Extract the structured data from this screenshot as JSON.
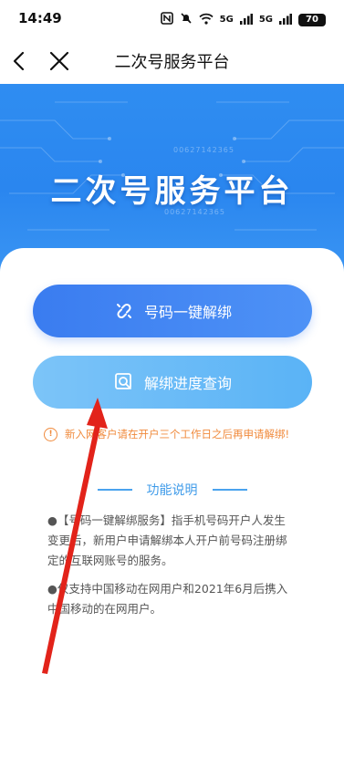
{
  "status_bar": {
    "time": "14:49",
    "signal_1": "5G",
    "signal_2": "5G",
    "battery": "70",
    "icons": [
      "nfc-icon",
      "mute-icon",
      "wifi-icon",
      "signal-icon",
      "signal-icon",
      "battery-icon"
    ]
  },
  "nav": {
    "title": "二次号服务平台",
    "back_icon": "chevron-left-icon",
    "close_icon": "close-icon"
  },
  "banner": {
    "title": "二次号服务平台",
    "digits_1": "00627142365",
    "digits_2": "00627142365"
  },
  "actions": {
    "unbind_label": "号码一键解绑",
    "progress_label": "解绑进度查询"
  },
  "notice": {
    "text": "新入网客户请在开户三个工作日之后再申请解绑!"
  },
  "section": {
    "title": "功能说明",
    "desc_1": "●【号码一键解绑服务】指手机号码开户人发生变更后，新用户申请解绑本人开户前号码注册绑定的互联网账号的服务。",
    "desc_2": "●仅支持中国移动在网用户和2021年6月后携入中国移动的在网用户。"
  },
  "colors": {
    "banner": "#2f8df1",
    "primary_button": "#3a7cf0",
    "secondary_button": "#6bbcf7",
    "notice": "#f08a3c",
    "section_title": "#3f9be9",
    "annotation": "#e2231a"
  }
}
